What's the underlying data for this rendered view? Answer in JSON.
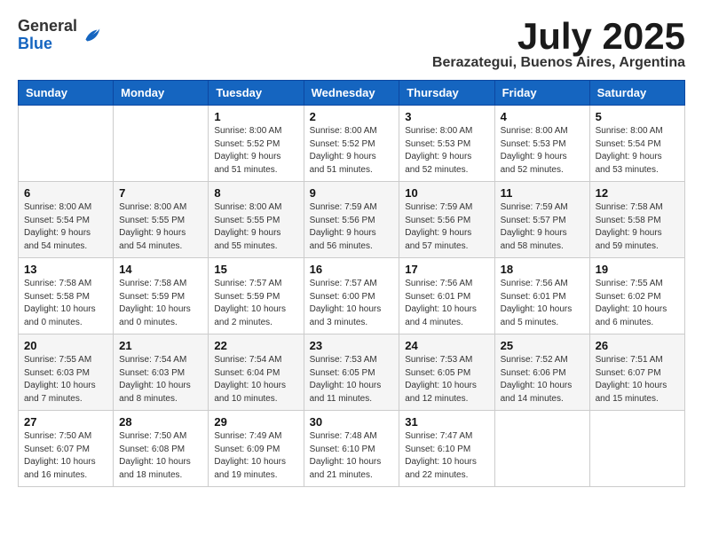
{
  "logo": {
    "general": "General",
    "blue": "Blue"
  },
  "title": "July 2025",
  "location": "Berazategui, Buenos Aires, Argentina",
  "days_of_week": [
    "Sunday",
    "Monday",
    "Tuesday",
    "Wednesday",
    "Thursday",
    "Friday",
    "Saturday"
  ],
  "weeks": [
    [
      {
        "day": "",
        "info": ""
      },
      {
        "day": "",
        "info": ""
      },
      {
        "day": "1",
        "info": "Sunrise: 8:00 AM\nSunset: 5:52 PM\nDaylight: 9 hours\nand 51 minutes."
      },
      {
        "day": "2",
        "info": "Sunrise: 8:00 AM\nSunset: 5:52 PM\nDaylight: 9 hours\nand 51 minutes."
      },
      {
        "day": "3",
        "info": "Sunrise: 8:00 AM\nSunset: 5:53 PM\nDaylight: 9 hours\nand 52 minutes."
      },
      {
        "day": "4",
        "info": "Sunrise: 8:00 AM\nSunset: 5:53 PM\nDaylight: 9 hours\nand 52 minutes."
      },
      {
        "day": "5",
        "info": "Sunrise: 8:00 AM\nSunset: 5:54 PM\nDaylight: 9 hours\nand 53 minutes."
      }
    ],
    [
      {
        "day": "6",
        "info": "Sunrise: 8:00 AM\nSunset: 5:54 PM\nDaylight: 9 hours\nand 54 minutes."
      },
      {
        "day": "7",
        "info": "Sunrise: 8:00 AM\nSunset: 5:55 PM\nDaylight: 9 hours\nand 54 minutes."
      },
      {
        "day": "8",
        "info": "Sunrise: 8:00 AM\nSunset: 5:55 PM\nDaylight: 9 hours\nand 55 minutes."
      },
      {
        "day": "9",
        "info": "Sunrise: 7:59 AM\nSunset: 5:56 PM\nDaylight: 9 hours\nand 56 minutes."
      },
      {
        "day": "10",
        "info": "Sunrise: 7:59 AM\nSunset: 5:56 PM\nDaylight: 9 hours\nand 57 minutes."
      },
      {
        "day": "11",
        "info": "Sunrise: 7:59 AM\nSunset: 5:57 PM\nDaylight: 9 hours\nand 58 minutes."
      },
      {
        "day": "12",
        "info": "Sunrise: 7:58 AM\nSunset: 5:58 PM\nDaylight: 9 hours\nand 59 minutes."
      }
    ],
    [
      {
        "day": "13",
        "info": "Sunrise: 7:58 AM\nSunset: 5:58 PM\nDaylight: 10 hours\nand 0 minutes."
      },
      {
        "day": "14",
        "info": "Sunrise: 7:58 AM\nSunset: 5:59 PM\nDaylight: 10 hours\nand 0 minutes."
      },
      {
        "day": "15",
        "info": "Sunrise: 7:57 AM\nSunset: 5:59 PM\nDaylight: 10 hours\nand 2 minutes."
      },
      {
        "day": "16",
        "info": "Sunrise: 7:57 AM\nSunset: 6:00 PM\nDaylight: 10 hours\nand 3 minutes."
      },
      {
        "day": "17",
        "info": "Sunrise: 7:56 AM\nSunset: 6:01 PM\nDaylight: 10 hours\nand 4 minutes."
      },
      {
        "day": "18",
        "info": "Sunrise: 7:56 AM\nSunset: 6:01 PM\nDaylight: 10 hours\nand 5 minutes."
      },
      {
        "day": "19",
        "info": "Sunrise: 7:55 AM\nSunset: 6:02 PM\nDaylight: 10 hours\nand 6 minutes."
      }
    ],
    [
      {
        "day": "20",
        "info": "Sunrise: 7:55 AM\nSunset: 6:03 PM\nDaylight: 10 hours\nand 7 minutes."
      },
      {
        "day": "21",
        "info": "Sunrise: 7:54 AM\nSunset: 6:03 PM\nDaylight: 10 hours\nand 8 minutes."
      },
      {
        "day": "22",
        "info": "Sunrise: 7:54 AM\nSunset: 6:04 PM\nDaylight: 10 hours\nand 10 minutes."
      },
      {
        "day": "23",
        "info": "Sunrise: 7:53 AM\nSunset: 6:05 PM\nDaylight: 10 hours\nand 11 minutes."
      },
      {
        "day": "24",
        "info": "Sunrise: 7:53 AM\nSunset: 6:05 PM\nDaylight: 10 hours\nand 12 minutes."
      },
      {
        "day": "25",
        "info": "Sunrise: 7:52 AM\nSunset: 6:06 PM\nDaylight: 10 hours\nand 14 minutes."
      },
      {
        "day": "26",
        "info": "Sunrise: 7:51 AM\nSunset: 6:07 PM\nDaylight: 10 hours\nand 15 minutes."
      }
    ],
    [
      {
        "day": "27",
        "info": "Sunrise: 7:50 AM\nSunset: 6:07 PM\nDaylight: 10 hours\nand 16 minutes."
      },
      {
        "day": "28",
        "info": "Sunrise: 7:50 AM\nSunset: 6:08 PM\nDaylight: 10 hours\nand 18 minutes."
      },
      {
        "day": "29",
        "info": "Sunrise: 7:49 AM\nSunset: 6:09 PM\nDaylight: 10 hours\nand 19 minutes."
      },
      {
        "day": "30",
        "info": "Sunrise: 7:48 AM\nSunset: 6:10 PM\nDaylight: 10 hours\nand 21 minutes."
      },
      {
        "day": "31",
        "info": "Sunrise: 7:47 AM\nSunset: 6:10 PM\nDaylight: 10 hours\nand 22 minutes."
      },
      {
        "day": "",
        "info": ""
      },
      {
        "day": "",
        "info": ""
      }
    ]
  ]
}
